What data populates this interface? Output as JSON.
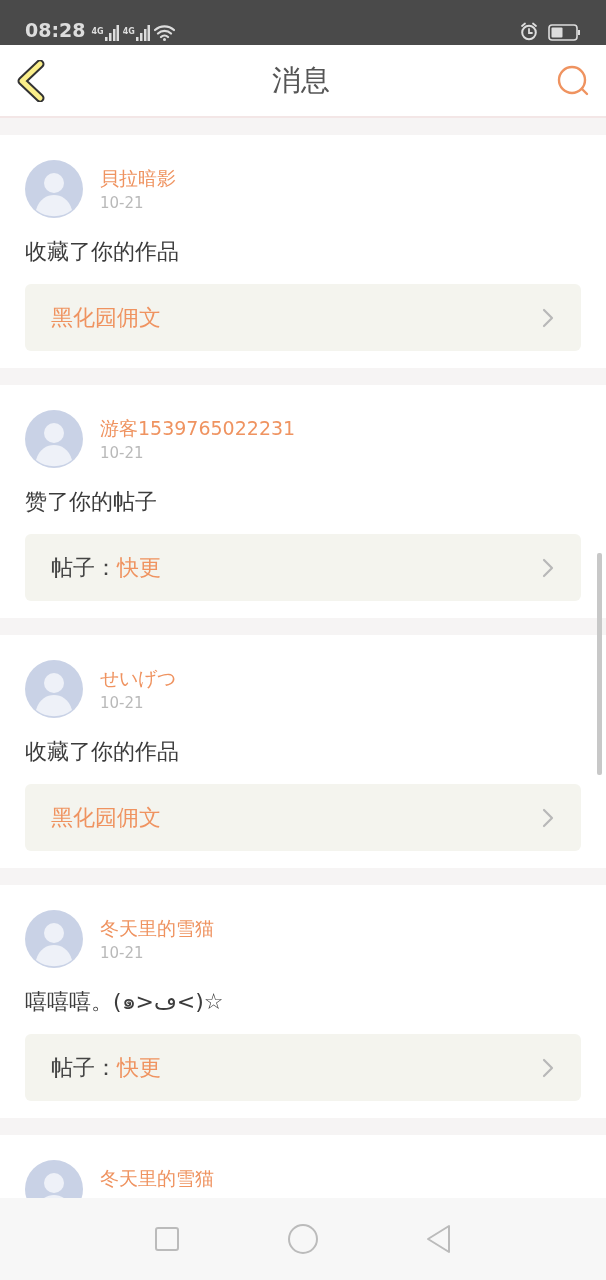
{
  "status_bar": {
    "time": "08:28",
    "networks": [
      "4G",
      "4G"
    ]
  },
  "header": {
    "title": "消息"
  },
  "messages": [
    {
      "user": "貝拉暗影",
      "date": "10-21",
      "text": "收藏了你的作品",
      "link": {
        "kind": "work",
        "title": "黑化园佣文"
      }
    },
    {
      "user": "游客1539765022231",
      "date": "10-21",
      "text": "赞了你的帖子",
      "link": {
        "kind": "post",
        "label": "帖子：",
        "title": "快更"
      }
    },
    {
      "user": "せいげつ",
      "date": "10-21",
      "text": "收藏了你的作品",
      "link": {
        "kind": "work",
        "title": "黑化园佣文"
      }
    },
    {
      "user": "冬天里的雪猫",
      "date": "10-21",
      "text": "嘻嘻嘻。(๑>ڡ<)☆",
      "link": {
        "kind": "post",
        "label": "帖子：",
        "title": "快更"
      }
    },
    {
      "user": "冬天里的雪猫"
    }
  ]
}
